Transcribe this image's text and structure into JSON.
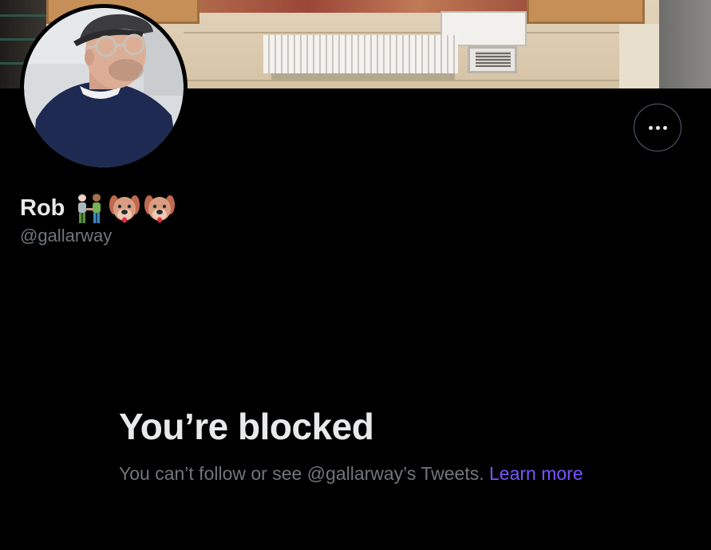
{
  "profile": {
    "display_name": "Rob",
    "handle": "@gallarway",
    "name_emojis": [
      "people-holding-hands-icon",
      "dog-face-icon",
      "dog-face-icon"
    ]
  },
  "actions": {
    "more_icon": "more-horizontal-icon"
  },
  "blocked": {
    "title": "You’re blocked",
    "message": "You can’t follow or see @gallarway’s Tweets.",
    "link_text": "Learn more"
  },
  "colors": {
    "background": "#000000",
    "primary_text": "#e7e9ea",
    "secondary_text": "#71767b",
    "link": "#7856ff",
    "button_border": "#536471"
  }
}
